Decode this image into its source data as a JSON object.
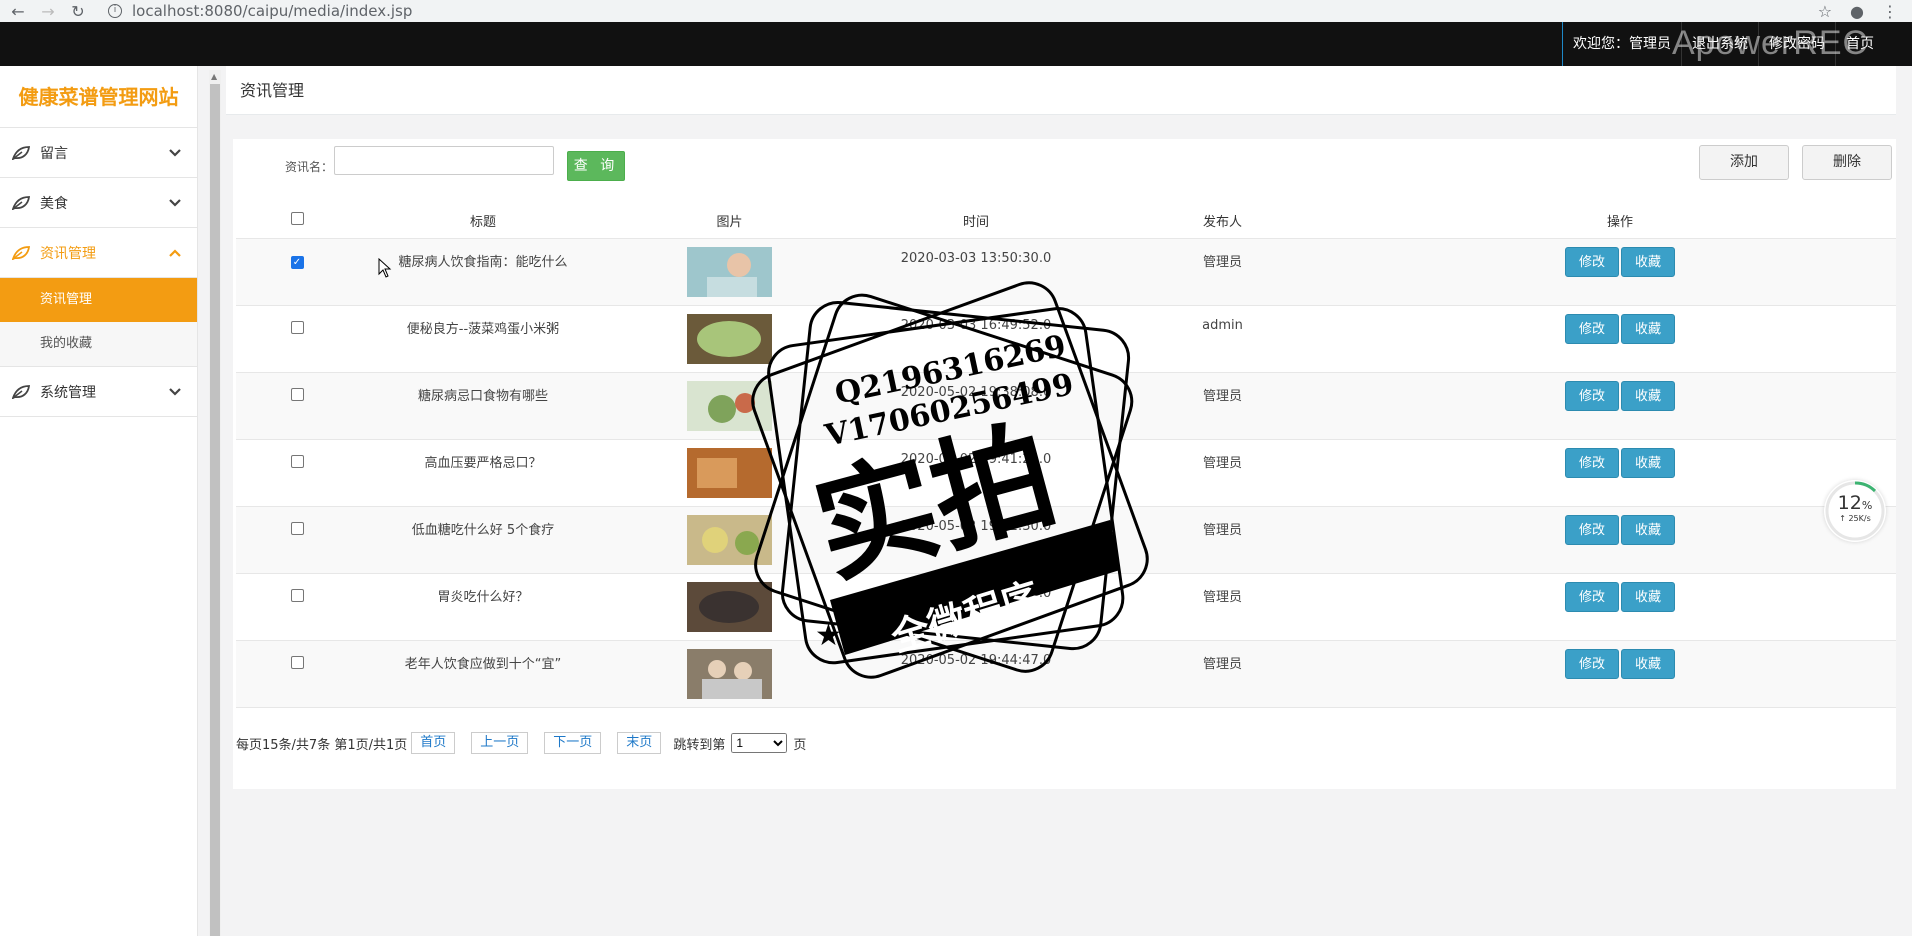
{
  "browser": {
    "url": "localhost:8080/caipu/media/index.jsp"
  },
  "topbar": {
    "welcome": "欢迎您：管理员",
    "logout": "退出系统",
    "change_password": "修改密码",
    "home": "首页"
  },
  "recorder_watermark": "ApowerREC",
  "sidebar": {
    "logo": "健康菜谱管理网站",
    "items": [
      {
        "label": "留言"
      },
      {
        "label": "美食"
      },
      {
        "label": "资讯管理"
      },
      {
        "label": "系统管理"
      }
    ],
    "subitems": [
      {
        "label": "资讯管理"
      },
      {
        "label": "我的收藏"
      }
    ]
  },
  "page": {
    "title": "资讯管理"
  },
  "search": {
    "label": "资讯名：",
    "value": "",
    "query_button": "查 询"
  },
  "toolbar": {
    "add": "添加",
    "delete": "删除"
  },
  "table": {
    "headers": [
      "标题",
      "图片",
      "时间",
      "发布人",
      "操作"
    ],
    "rows": [
      {
        "title": "糖尿病人饮食指南：能吃什么",
        "time": "2020-03-03 13:50:30.0",
        "author": "管理员",
        "edit": "修改",
        "fav": "收藏"
      },
      {
        "title": "便秘良方--菠菜鸡蛋小米粥",
        "time": "2020-03-03 16:49:52.0",
        "author": "admin",
        "edit": "修改",
        "fav": "收藏"
      },
      {
        "title": "糖尿病忌口食物有哪些",
        "time": "2020-05-02 19:38:08.0",
        "author": "管理员",
        "edit": "修改",
        "fav": "收藏"
      },
      {
        "title": "高血压要严格忌口？",
        "time": "2020-05-02 19:41:24.0",
        "author": "管理员",
        "edit": "修改",
        "fav": "收藏"
      },
      {
        "title": "低血糖吃什么好 5个食疗",
        "time": "2020-05-02 19:42:30.0",
        "author": "管理员",
        "edit": "修改",
        "fav": "收藏"
      },
      {
        "title": "胃炎吃什么好？",
        "time": "2020-05-02 19:43:55.0",
        "author": "管理员",
        "edit": "修改",
        "fav": "收藏"
      },
      {
        "title": "老年人饮食应做到十个“宜”",
        "time": "2020-05-02 19:44:47.0",
        "author": "管理员",
        "edit": "修改",
        "fav": "收藏"
      }
    ]
  },
  "pager": {
    "info": "每页15条/共7条 第1页/共1页",
    "first": "首页",
    "prev": "上一页",
    "next": "下一页",
    "last": "末页",
    "jump_label": "跳转到第",
    "page_value": "1",
    "page_suffix": "页"
  },
  "watermark": {
    "qq": "Q2196316269",
    "wechat": "V17060256499",
    "big_text": "实拍",
    "ribbon": "全微程序"
  },
  "speed_widget": {
    "percent": "12",
    "percent_unit": "%",
    "rate": "↑ 25K/s"
  },
  "colors": {
    "accent": "#f39c12",
    "query_btn": "#5cb85c",
    "op_btn": "#3ba0c8"
  }
}
